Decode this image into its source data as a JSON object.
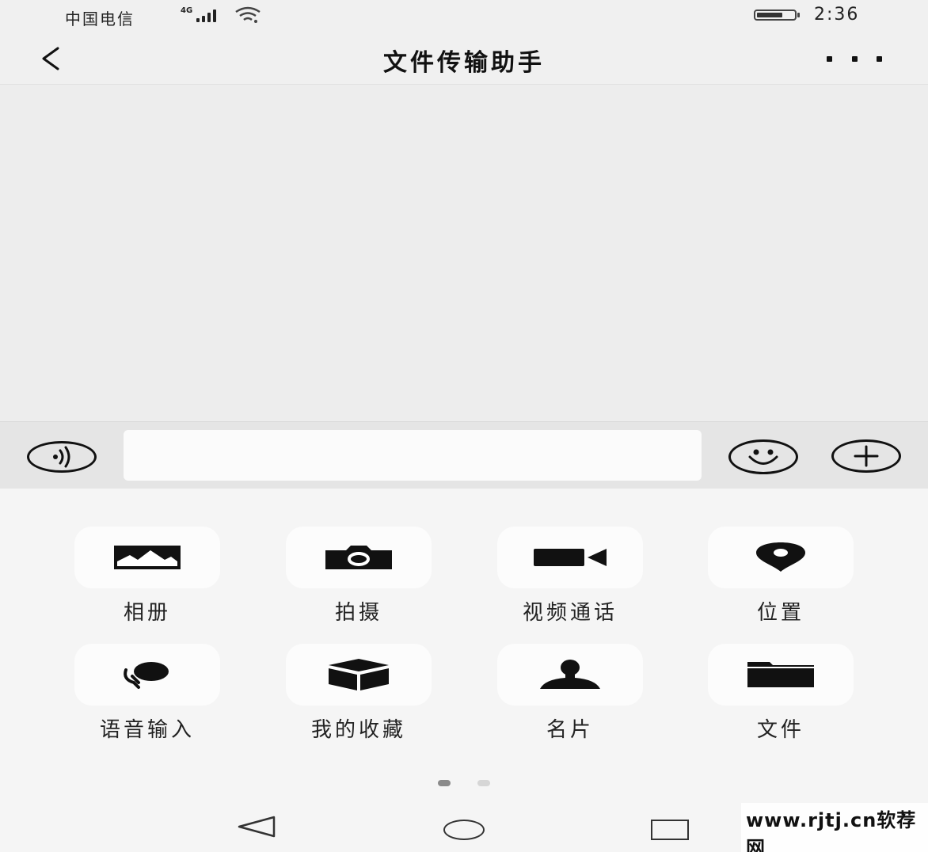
{
  "status_bar": {
    "carrier": "中国电信",
    "network_type": "4G",
    "time": "2:36",
    "battery_level": 0.7
  },
  "title_bar": {
    "title": "文件传输助手"
  },
  "input_bar": {
    "text_value": ""
  },
  "function_panel": {
    "items": [
      {
        "label": "相册",
        "icon": "photo-icon"
      },
      {
        "label": "拍摄",
        "icon": "camera-icon"
      },
      {
        "label": "视频通话",
        "icon": "video-call-icon"
      },
      {
        "label": "位置",
        "icon": "location-icon"
      },
      {
        "label": "语音输入",
        "icon": "voice-input-icon"
      },
      {
        "label": "我的收藏",
        "icon": "favorites-icon"
      },
      {
        "label": "名片",
        "icon": "contact-card-icon"
      },
      {
        "label": "文件",
        "icon": "folder-icon"
      }
    ],
    "page_count": 2,
    "current_page": 1
  },
  "watermark": {
    "text": "www.rjtj.cn软荐网"
  },
  "colors": {
    "background": "#ededed",
    "panel": "#f5f5f5",
    "tile": "#fcfcfc",
    "icon": "#111111",
    "dot_active": "#8a8a8a",
    "dot_inactive": "#d6d6d6"
  }
}
